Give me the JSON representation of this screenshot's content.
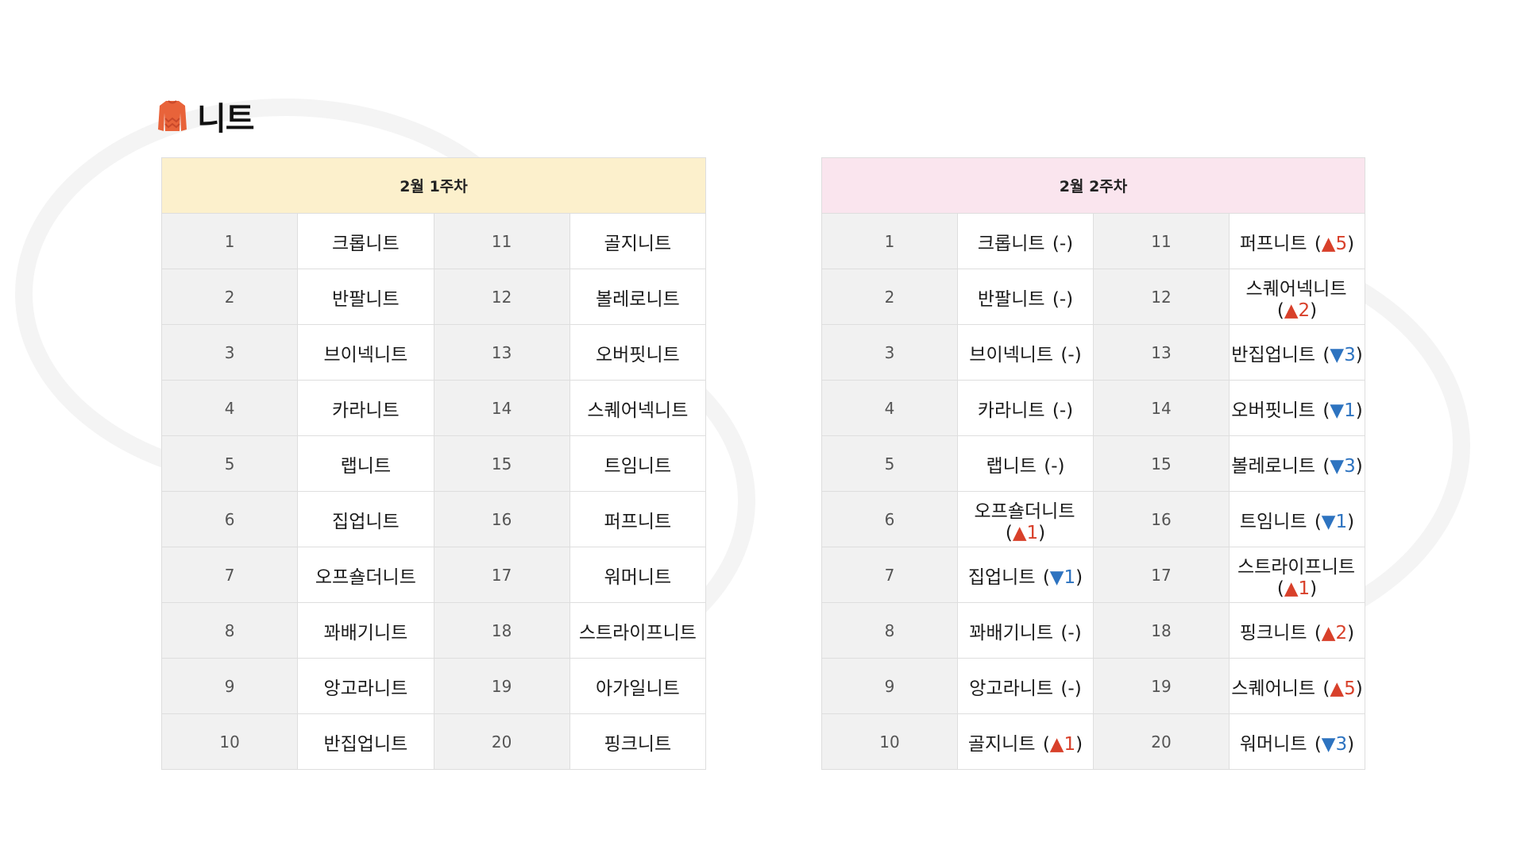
{
  "page": {
    "title": "니트",
    "title_icon": "sweater-icon"
  },
  "colors": {
    "week1_header_bg": "#fcf0cc",
    "week2_header_bg": "#fae5ee",
    "rank_up": "#d8402a",
    "rank_down": "#2d73c0",
    "rank_cell_bg": "#f1f1f1",
    "border": "#dedede",
    "icon": "#e8633a"
  },
  "week1": {
    "header": "2월 1주차",
    "rows": [
      {
        "left": {
          "rank": "1",
          "name": "크롭니트"
        },
        "right": {
          "rank": "11",
          "name": "골지니트"
        }
      },
      {
        "left": {
          "rank": "2",
          "name": "반팔니트"
        },
        "right": {
          "rank": "12",
          "name": "볼레로니트"
        }
      },
      {
        "left": {
          "rank": "3",
          "name": "브이넥니트"
        },
        "right": {
          "rank": "13",
          "name": "오버핏니트"
        }
      },
      {
        "left": {
          "rank": "4",
          "name": "카라니트"
        },
        "right": {
          "rank": "14",
          "name": "스퀘어넥니트"
        }
      },
      {
        "left": {
          "rank": "5",
          "name": "랩니트"
        },
        "right": {
          "rank": "15",
          "name": "트임니트"
        }
      },
      {
        "left": {
          "rank": "6",
          "name": "집업니트"
        },
        "right": {
          "rank": "16",
          "name": "퍼프니트"
        }
      },
      {
        "left": {
          "rank": "7",
          "name": "오프숄더니트"
        },
        "right": {
          "rank": "17",
          "name": "워머니트"
        }
      },
      {
        "left": {
          "rank": "8",
          "name": "꽈배기니트"
        },
        "right": {
          "rank": "18",
          "name": "스트라이프니트"
        }
      },
      {
        "left": {
          "rank": "9",
          "name": "앙고라니트"
        },
        "right": {
          "rank": "19",
          "name": "아가일니트"
        }
      },
      {
        "left": {
          "rank": "10",
          "name": "반집업니트"
        },
        "right": {
          "rank": "20",
          "name": "핑크니트"
        }
      }
    ]
  },
  "week2": {
    "header": "2월 2주차",
    "rows": [
      {
        "left": {
          "rank": "1",
          "name": "크롭니트",
          "change": {
            "dir": "same",
            "symbol": "-",
            "amount": ""
          }
        },
        "right": {
          "rank": "11",
          "name": "퍼프니트",
          "change": {
            "dir": "up",
            "symbol": "▲",
            "amount": "5"
          }
        }
      },
      {
        "left": {
          "rank": "2",
          "name": "반팔니트",
          "change": {
            "dir": "same",
            "symbol": "-",
            "amount": ""
          }
        },
        "right": {
          "rank": "12",
          "name": "스퀘어넥니트",
          "change": {
            "dir": "up",
            "symbol": "▲",
            "amount": "2"
          }
        }
      },
      {
        "left": {
          "rank": "3",
          "name": "브이넥니트",
          "change": {
            "dir": "same",
            "symbol": "-",
            "amount": ""
          }
        },
        "right": {
          "rank": "13",
          "name": "반집업니트",
          "change": {
            "dir": "down",
            "symbol": "▼",
            "amount": "3"
          }
        }
      },
      {
        "left": {
          "rank": "4",
          "name": "카라니트",
          "change": {
            "dir": "same",
            "symbol": "-",
            "amount": ""
          }
        },
        "right": {
          "rank": "14",
          "name": "오버핏니트",
          "change": {
            "dir": "down",
            "symbol": "▼",
            "amount": "1"
          }
        }
      },
      {
        "left": {
          "rank": "5",
          "name": "랩니트",
          "change": {
            "dir": "same",
            "symbol": "-",
            "amount": ""
          }
        },
        "right": {
          "rank": "15",
          "name": "볼레로니트",
          "change": {
            "dir": "down",
            "symbol": "▼",
            "amount": "3"
          }
        }
      },
      {
        "left": {
          "rank": "6",
          "name": "오프숄더니트",
          "change": {
            "dir": "up",
            "symbol": "▲",
            "amount": "1"
          }
        },
        "right": {
          "rank": "16",
          "name": "트임니트",
          "change": {
            "dir": "down",
            "symbol": "▼",
            "amount": "1"
          }
        }
      },
      {
        "left": {
          "rank": "7",
          "name": "집업니트",
          "change": {
            "dir": "down",
            "symbol": "▼",
            "amount": "1"
          }
        },
        "right": {
          "rank": "17",
          "name": "스트라이프니트",
          "change": {
            "dir": "up",
            "symbol": "▲",
            "amount": "1"
          }
        }
      },
      {
        "left": {
          "rank": "8",
          "name": "꽈배기니트",
          "change": {
            "dir": "same",
            "symbol": "-",
            "amount": ""
          }
        },
        "right": {
          "rank": "18",
          "name": "핑크니트",
          "change": {
            "dir": "up",
            "symbol": "▲",
            "amount": "2"
          }
        }
      },
      {
        "left": {
          "rank": "9",
          "name": "앙고라니트",
          "change": {
            "dir": "same",
            "symbol": "-",
            "amount": ""
          }
        },
        "right": {
          "rank": "19",
          "name": "스퀘어니트",
          "change": {
            "dir": "up",
            "symbol": "▲",
            "amount": "5"
          }
        }
      },
      {
        "left": {
          "rank": "10",
          "name": "골지니트",
          "change": {
            "dir": "up",
            "symbol": "▲",
            "amount": "1"
          }
        },
        "right": {
          "rank": "20",
          "name": "워머니트",
          "change": {
            "dir": "down",
            "symbol": "▼",
            "amount": "3"
          }
        }
      }
    ]
  }
}
